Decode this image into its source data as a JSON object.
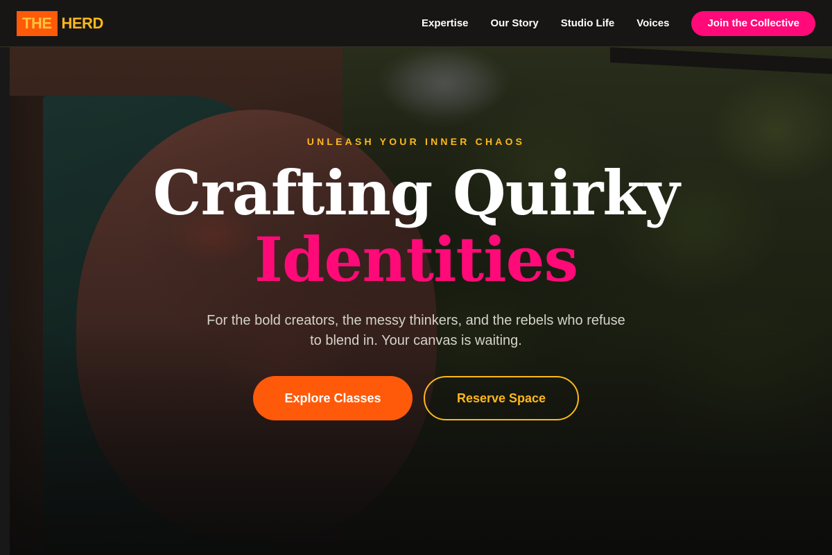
{
  "logo": {
    "box_text": "THE",
    "text": "HERD"
  },
  "nav": {
    "links": [
      "Expertise",
      "Our Story",
      "Studio Life",
      "Voices"
    ],
    "cta_label": "Join the Collective"
  },
  "hero": {
    "eyebrow": "UNLEASH YOUR INNER CHAOS",
    "headline_line1": "Crafting Quirky",
    "headline_line2": "Identities",
    "subtitle": "For the bold creators, the messy thinkers, and the rebels who refuse to blend in. Your canvas is waiting.",
    "primary_button": "Explore Classes",
    "secondary_button": "Reserve Space"
  },
  "colors": {
    "orange": "#ff5a0a",
    "pink": "#ff0a78",
    "gold": "#ffb81c",
    "header_bg": "#171615"
  }
}
